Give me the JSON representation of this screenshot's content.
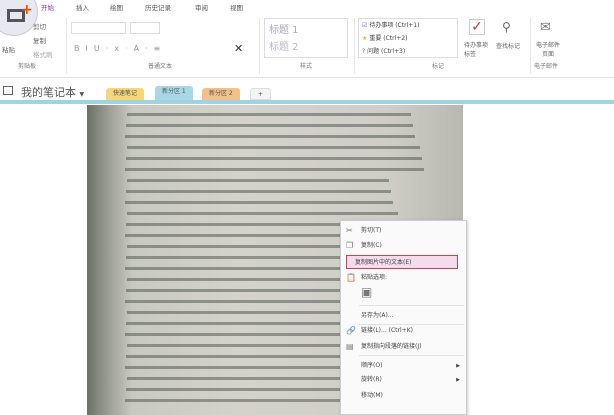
{
  "tabs": [
    "开始",
    "插入",
    "绘图",
    "历史记录",
    "审阅",
    "视图"
  ],
  "clipboard": {
    "paste": "粘贴",
    "cut": "剪切",
    "copy": "复制",
    "format_painter": "格式刷",
    "group": "剪贴板"
  },
  "basic_text": {
    "group": "普通文本"
  },
  "styles": {
    "h1": "标题 1",
    "h2": "标题 2",
    "group": "样式"
  },
  "tags": {
    "items": [
      {
        "icon": "checkbox-icon",
        "label": "待办事项 (Ctrl+1)"
      },
      {
        "icon": "star-icon",
        "label": "重要 (Ctrl+2)"
      },
      {
        "icon": "question-icon",
        "label": "问题 (Ctrl+3)"
      }
    ],
    "todo_tag": "待办事项标签",
    "find_tags": "查找标记",
    "group": "标记"
  },
  "email": {
    "label": "电子邮件页面",
    "group": "电子邮件"
  },
  "notebook": {
    "name": "我的笔记本",
    "sections": [
      {
        "label": "快速笔记",
        "color": "#f5d77a"
      },
      {
        "label": "新分区 1",
        "color": "#a8d8e6"
      },
      {
        "label": "新分区 2",
        "color": "#f3c08a"
      }
    ],
    "add": "+"
  },
  "context_menu": {
    "items": [
      {
        "label": "剪切(T)",
        "icon": "cut-icon"
      },
      {
        "label": "复制(C)",
        "icon": "copy-icon"
      },
      {
        "label": "复制图片中的文本(E)",
        "highlight": true
      },
      {
        "label": "粘贴选项:",
        "icon": "paste-icon"
      },
      {
        "label": "",
        "icon": "paste-picture-icon"
      },
      {
        "label": "另存为(A)..."
      },
      {
        "label": "链接(L)...  (Ctrl+K)",
        "icon": "link-icon"
      },
      {
        "label": "复制指向段落的链接(J)",
        "icon": "page-link-icon"
      },
      {
        "label": "顺序(O)",
        "submenu": true
      },
      {
        "label": "旋转(R)",
        "submenu": true
      },
      {
        "label": "移动(M)"
      }
    ]
  }
}
